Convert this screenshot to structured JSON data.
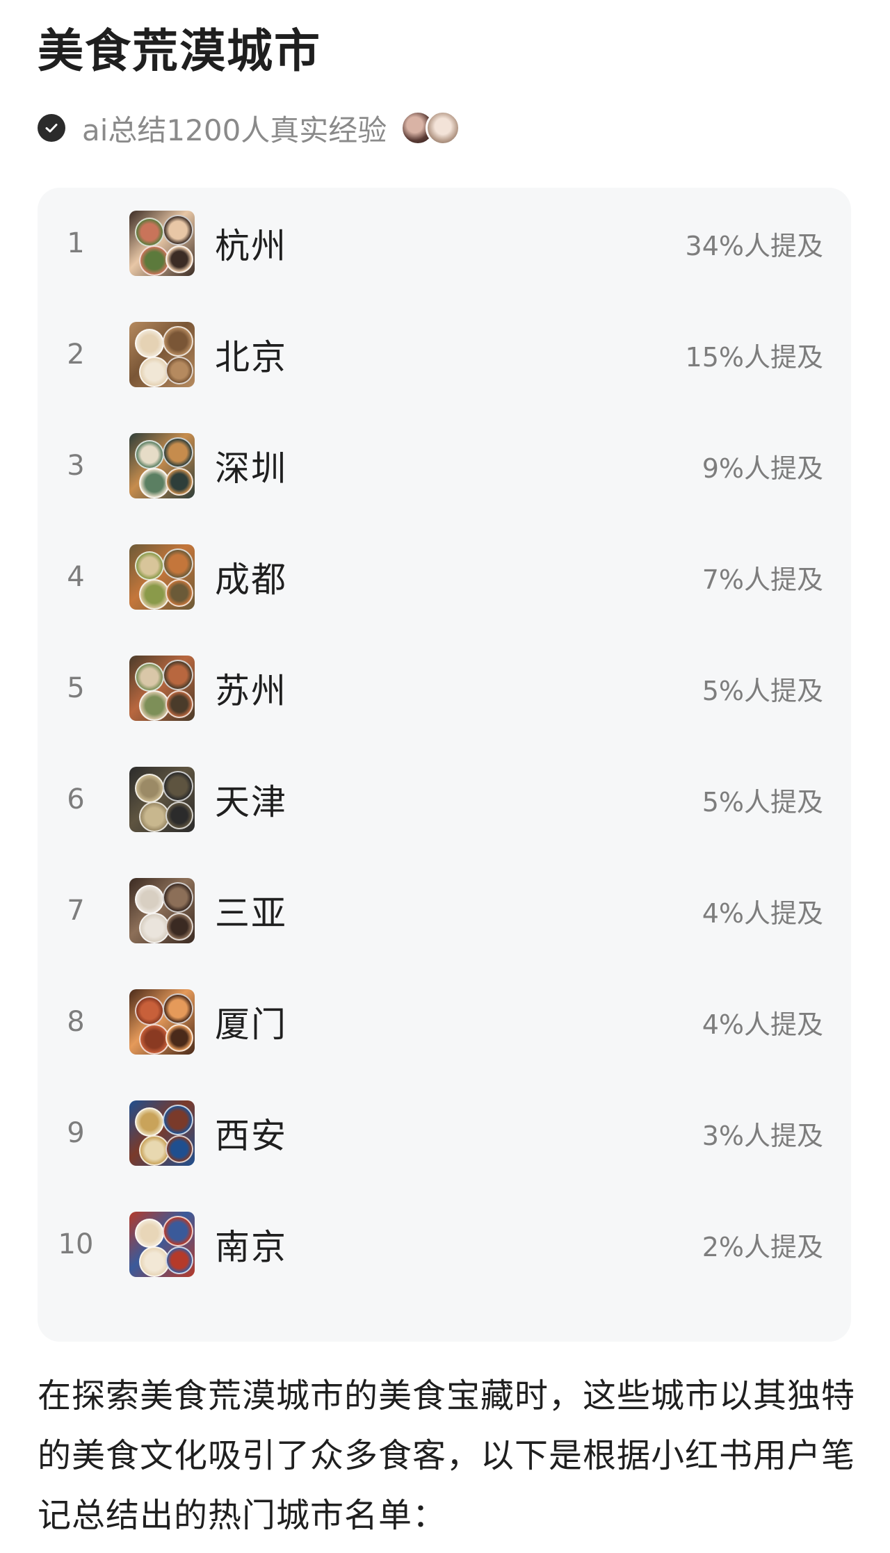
{
  "header": {
    "title": "美食荒漠城市",
    "subtitle": "ai总结1200人真实经验"
  },
  "ranking": [
    {
      "rank": "1",
      "city": "杭州",
      "mention": "34%人提及",
      "thumb_colors": [
        "#3b2c25",
        "#c9745a",
        "#e8c7a6",
        "#5c7a3c"
      ]
    },
    {
      "rank": "2",
      "city": "北京",
      "mention": "15%人提及",
      "thumb_colors": [
        "#b58a5f",
        "#e5d2b4",
        "#7a5636",
        "#f1e7d6"
      ]
    },
    {
      "rank": "3",
      "city": "深圳",
      "mention": "9%人提及",
      "thumb_colors": [
        "#2e3e3a",
        "#e6dcc7",
        "#c68c4d",
        "#5b7f62"
      ]
    },
    {
      "rank": "4",
      "city": "成都",
      "mention": "7%人提及",
      "thumb_colors": [
        "#6b5a38",
        "#d8c59a",
        "#c4763b",
        "#8a9a4a"
      ]
    },
    {
      "rank": "5",
      "city": "苏州",
      "mention": "5%人提及",
      "thumb_colors": [
        "#4a3b2a",
        "#d9c7a8",
        "#b8673f",
        "#7d8f58"
      ]
    },
    {
      "rank": "6",
      "city": "天津",
      "mention": "5%人提及",
      "thumb_colors": [
        "#2b2b2b",
        "#9b8a66",
        "#5e5440",
        "#c8b78e"
      ]
    },
    {
      "rank": "7",
      "city": "三亚",
      "mention": "4%人提及",
      "thumb_colors": [
        "#3a2a22",
        "#d8cfc2",
        "#8c6f58",
        "#eae4dc"
      ]
    },
    {
      "rank": "8",
      "city": "厦门",
      "mention": "4%人提及",
      "thumb_colors": [
        "#4a2a1a",
        "#c8603a",
        "#e59a5a",
        "#8a3a22"
      ]
    },
    {
      "rank": "9",
      "city": "西安",
      "mention": "3%人提及",
      "thumb_colors": [
        "#1f4f8f",
        "#c9a35a",
        "#7a3a2a",
        "#e8d8b0"
      ]
    },
    {
      "rank": "10",
      "city": "南京",
      "mention": "2%人提及",
      "thumb_colors": [
        "#b53a2a",
        "#e8d6b8",
        "#3a5a9a",
        "#f2e8d6"
      ]
    }
  ],
  "description": "在探索美食荒漠城市的美食宝藏时，这些城市以其独特的美食文化吸引了众多食客，以下是根据小红书用户笔记总结出的热门城市名单："
}
